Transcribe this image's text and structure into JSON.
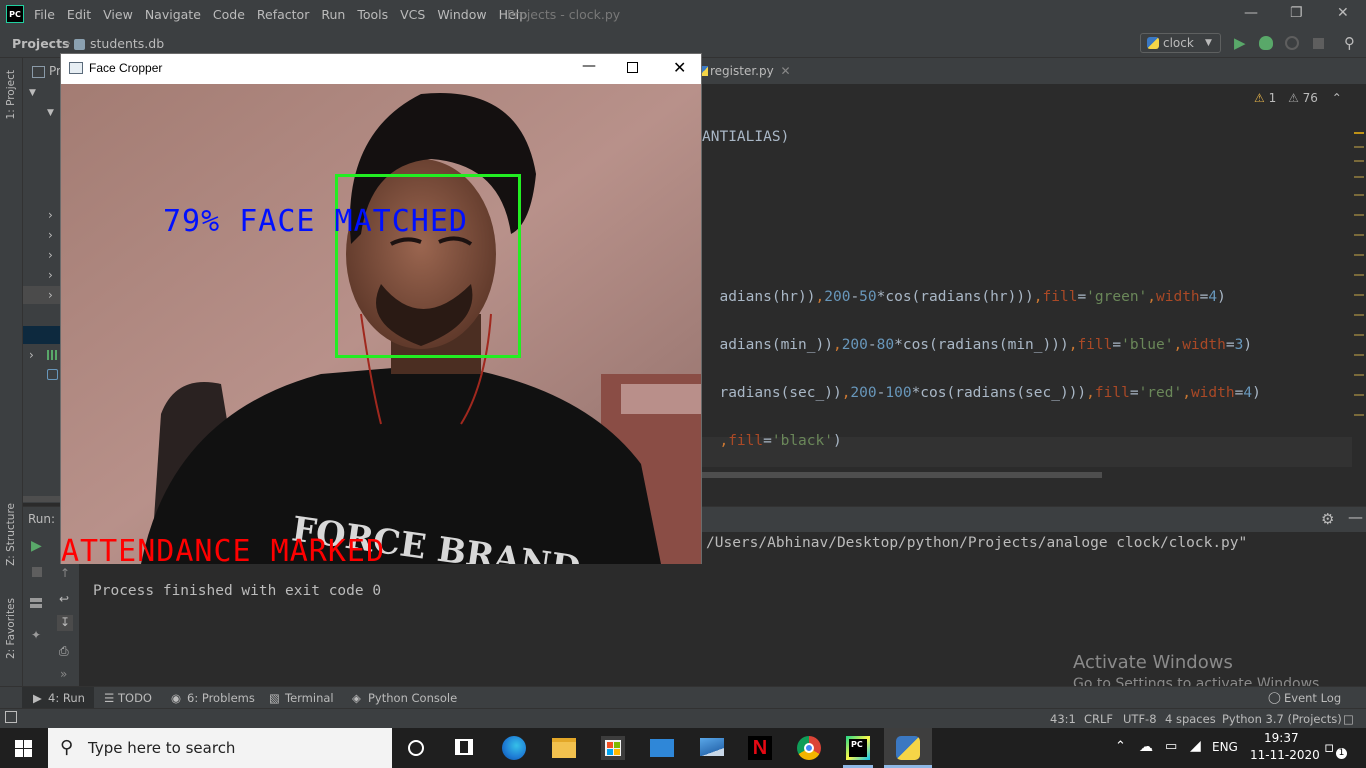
{
  "ide": {
    "menu": [
      "File",
      "Edit",
      "View",
      "Navigate",
      "Code",
      "Refactor",
      "Run",
      "Tools",
      "VCS",
      "Window",
      "Help"
    ],
    "title": "Projects - clock.py",
    "logo": "PC",
    "nav": {
      "projects": "Projects",
      "file": "students.db"
    },
    "run_config": "clock",
    "tab_register": "register.py",
    "tab_project_partial": "Pr",
    "inspections": {
      "errors": "1",
      "warnings": "76"
    },
    "code_lines": [
      {
        "text": "ANTIALIAS)"
      },
      {
        "parts": [
          "adians(hr))",
          ",",
          "200",
          "-",
          "50",
          "*cos(radians(hr)))",
          ",",
          "fill",
          "=",
          "'green'",
          ",",
          "width",
          "=",
          "4",
          ")"
        ]
      },
      {
        "parts": [
          "adians(min_))",
          ",",
          "200",
          "-",
          "80",
          "*cos(radians(min_)))",
          ",",
          "fill",
          "=",
          "'blue'",
          ",",
          "width",
          "=",
          "3",
          ")"
        ]
      },
      {
        "parts": [
          "radians(sec_))",
          ",",
          "200",
          "-",
          "100",
          "*cos(radians(sec_)))",
          ",",
          "fill",
          "=",
          "'red'",
          ",",
          "width",
          "=",
          "4",
          ")"
        ]
      },
      {
        "parts": [
          ",",
          "fill",
          "=",
          "'black'",
          ")"
        ]
      }
    ],
    "run": {
      "label": "Run:",
      "command_tail": "/Users/Abhinav/Desktop/python/Projects/analoge clock/clock.py\"",
      "exit_message": "Process finished with exit code 0"
    },
    "side_labels": {
      "project": "1: Project",
      "structure": "Z: Structure",
      "favorites": "2: Favorites"
    },
    "tool_tabs": [
      "4: Run",
      "TODO",
      "6: Problems",
      "Terminal",
      "Python Console"
    ],
    "event_log": "Event Log",
    "status": {
      "position": "43:1",
      "line_sep": "CRLF",
      "encoding": "UTF-8",
      "indent": "4 spaces",
      "interpreter": "Python 3.7 (Projects)"
    }
  },
  "watermark": {
    "line1": "Activate Windows",
    "line2": "Go to Settings to activate Windows."
  },
  "face_cropper": {
    "title": "Face Cropper",
    "match_text": "79% FACE MATCHED",
    "attendance_text": "ATTENDANCE MARKED",
    "shirt_text": "FORCE BRAND",
    "colors": {
      "match": "#0010ff",
      "attendance": "#ff0000",
      "box": "#22ee22"
    }
  },
  "taskbar": {
    "search_placeholder": "Type here to search",
    "language": "ENG",
    "time": "19:37",
    "date": "11-11-2020",
    "notification_count": "1",
    "pinned": [
      "task-view-icon",
      "edge-icon",
      "file-explorer-icon",
      "store-icon",
      "mail-icon",
      "scanner-icon",
      "netflix-icon",
      "chrome-icon",
      "pycharm-icon",
      "python-icon"
    ]
  }
}
